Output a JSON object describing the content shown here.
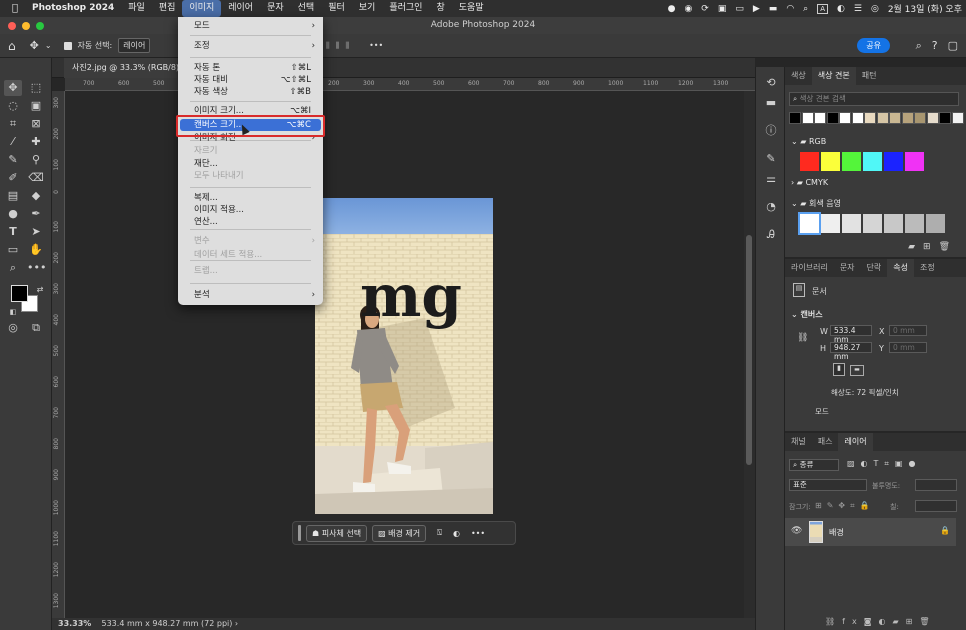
{
  "menubar": {
    "app": "Photoshop 2024",
    "items": [
      "파일",
      "편집",
      "이미지",
      "레이어",
      "문자",
      "선택",
      "필터",
      "보기",
      "플러그인",
      "창",
      "도움말"
    ],
    "active_index": 2,
    "clock": "2월 13일 (화) 오후",
    "a_label": "A"
  },
  "titlebar": {
    "title": "Adobe Photoshop 2024"
  },
  "options": {
    "autoselect_label": "자동 선택:",
    "autoselect_value": "레이어",
    "share_label": "공유"
  },
  "document": {
    "tab_title": "사진2.jpg @ 33.3% (RGB/8)",
    "zoom": "33.33%",
    "doc_info": "533.4 mm x 948.27 mm (72 ppi)",
    "logo_text": "mg"
  },
  "ruler": {
    "h_ticks": [
      "700",
      "600",
      "500",
      "400",
      "100",
      "0",
      "100",
      "200",
      "300",
      "400",
      "500",
      "600",
      "700",
      "800",
      "900",
      "1000",
      "1100",
      "1200",
      "1300"
    ],
    "v_ticks": [
      "300",
      "200",
      "100",
      "0",
      "100",
      "200",
      "300",
      "400",
      "500",
      "600",
      "700",
      "800",
      "900",
      "1000",
      "1100",
      "1200",
      "1300"
    ]
  },
  "image_menu": {
    "items": [
      {
        "label": "모드",
        "shortcut": "",
        "arrow": true,
        "disabled": false
      },
      {
        "label": "조정",
        "shortcut": "",
        "arrow": true,
        "disabled": false
      },
      {
        "label": "자동 톤",
        "shortcut": "⇧⌘L",
        "arrow": false,
        "disabled": false
      },
      {
        "label": "자동 대비",
        "shortcut": "⌥⇧⌘L",
        "arrow": false,
        "disabled": false
      },
      {
        "label": "자동 색상",
        "shortcut": "⇧⌘B",
        "arrow": false,
        "disabled": false
      },
      {
        "label": "이미지 크기...",
        "shortcut": "⌥⌘I",
        "arrow": false,
        "disabled": false
      },
      {
        "label": "캔버스 크기...",
        "shortcut": "⌥⌘C",
        "arrow": false,
        "disabled": false,
        "highlighted": true
      },
      {
        "label": "이미지 회전",
        "shortcut": "",
        "arrow": true,
        "disabled": false
      },
      {
        "label": "자르기",
        "shortcut": "",
        "arrow": false,
        "disabled": true
      },
      {
        "label": "재단...",
        "shortcut": "",
        "arrow": false,
        "disabled": false
      },
      {
        "label": "모두 나타내기",
        "shortcut": "",
        "arrow": false,
        "disabled": true
      },
      {
        "label": "복제...",
        "shortcut": "",
        "arrow": false,
        "disabled": false
      },
      {
        "label": "이미지 적용...",
        "shortcut": "",
        "arrow": false,
        "disabled": false
      },
      {
        "label": "연산...",
        "shortcut": "",
        "arrow": false,
        "disabled": false
      },
      {
        "label": "변수",
        "shortcut": "",
        "arrow": true,
        "disabled": true
      },
      {
        "label": "데이터 세트 적용...",
        "shortcut": "",
        "arrow": false,
        "disabled": true
      },
      {
        "label": "트랩...",
        "shortcut": "",
        "arrow": false,
        "disabled": true
      },
      {
        "label": "분석",
        "shortcut": "",
        "arrow": true,
        "disabled": false
      }
    ]
  },
  "context_bar": {
    "subject_label": "피사체 선택",
    "remove_bg_label": "배경 제거"
  },
  "swatches_panel": {
    "tabs": [
      "색상",
      "색상 견본",
      "패턴"
    ],
    "active_tab": 1,
    "search_placeholder": "색상 견본 검색",
    "recent_colors": [
      "#000000",
      "#ffffff",
      "#ffffff",
      "#000000",
      "#ffffff",
      "#ffffff",
      "#e8d9bf",
      "#d6c6a6",
      "#c9b792",
      "#b7a37c",
      "#a89670",
      "#e6dccc",
      "#000000",
      "#f2f2f2"
    ],
    "groups": [
      {
        "name": "RGB",
        "colors": [
          "#ff2a1f",
          "#fbff3a",
          "#54f53a",
          "#50f7f7",
          "#1b23ff",
          "#f032f5"
        ]
      },
      {
        "name": "CMYK",
        "colors": []
      },
      {
        "name": "회색 음영",
        "colors": [
          "#ffffff",
          "#efefef",
          "#e2e2e2",
          "#d5d5d5",
          "#c8c8c8",
          "#bbbbbb",
          "#aeaeae"
        ]
      }
    ]
  },
  "properties_panel": {
    "tabs": [
      "라이브러리",
      "문자",
      "단락",
      "속성",
      "조정"
    ],
    "active_tab": 3,
    "doc_label": "문서",
    "section_label": "캔버스",
    "w_label": "W",
    "w_value": "533.4 mm",
    "h_label": "H",
    "h_value": "948.27 mm",
    "x_label": "X",
    "x_placeholder": "0 mm",
    "y_label": "Y",
    "y_placeholder": "0 mm",
    "resolution": "해상도: 72 픽셀/인치",
    "mode_label": "모드"
  },
  "layers_panel": {
    "tabs": [
      "채널",
      "패스",
      "레이어"
    ],
    "active_tab": 2,
    "kind_label": "종류",
    "blend_mode": "표준",
    "opacity_label": "불투명도:",
    "lock_label": "잠그기:",
    "fill_label": "칠:",
    "layers": [
      {
        "name": "배경",
        "locked": true,
        "visible": true
      }
    ]
  }
}
